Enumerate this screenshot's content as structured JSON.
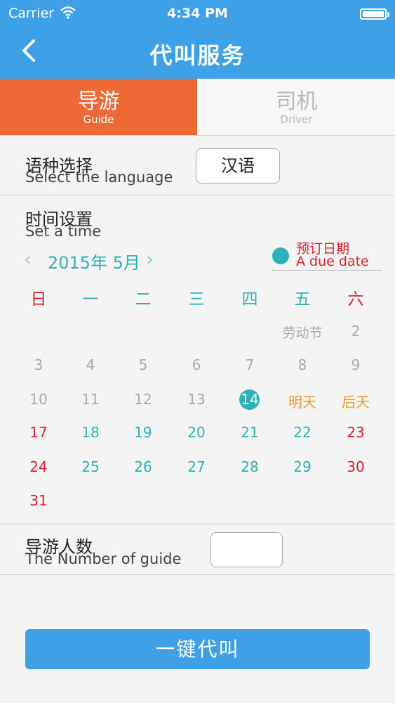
{
  "status_bar": {
    "carrier": "Carrier",
    "time": "4:34 PM"
  },
  "nav": {
    "back_icon": "chevron-left-icon",
    "title": "代叫服务"
  },
  "tabs": [
    {
      "zh": "导游",
      "en": "Guide",
      "active": true
    },
    {
      "zh": "司机",
      "en": "Driver",
      "active": false
    }
  ],
  "language": {
    "label_zh": "语种选择",
    "label_en": "Select the language",
    "value": "汉语"
  },
  "time_setting": {
    "label_zh": "时间设置",
    "label_en": "Set a time"
  },
  "calendar": {
    "month_label": "2015年 5月",
    "legend": {
      "zh": "预订日期",
      "en": "A due date"
    },
    "weekdays": [
      "日",
      "一",
      "二",
      "三",
      "四",
      "五",
      "六"
    ],
    "rows": [
      [
        "",
        "",
        "",
        "",
        "",
        "劳动节",
        "2"
      ],
      [
        "3",
        "4",
        "5",
        "6",
        "7",
        "8",
        "9"
      ],
      [
        "10",
        "11",
        "12",
        "13",
        "14",
        "明天",
        "后天"
      ],
      [
        "17",
        "18",
        "19",
        "20",
        "21",
        "22",
        "23"
      ],
      [
        "24",
        "25",
        "26",
        "27",
        "28",
        "29",
        "30"
      ],
      [
        "31",
        "",
        "",
        "",
        "",
        "",
        ""
      ]
    ],
    "selected_day": "14",
    "colors": {
      "weekend": "#e31d2a",
      "weekday": "#2eb1b8",
      "disabled": "#a8a8a8",
      "upcoming": "#f39a2a",
      "selected_bg": "#2eb1b8"
    }
  },
  "guide_count": {
    "label_zh": "导游人数",
    "label_en": "The Number of guide",
    "value": ""
  },
  "submit": {
    "label": "一键代叫"
  },
  "colors": {
    "primary": "#3ea0e6",
    "tab_active": "#ef6937"
  }
}
